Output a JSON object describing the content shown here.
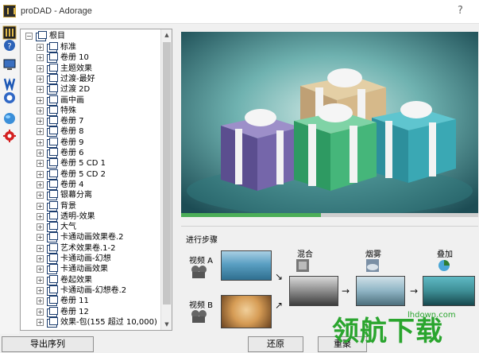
{
  "window": {
    "title": "proDAD - Adorage"
  },
  "titlebar": {
    "help": "?"
  },
  "tree": {
    "root": "根目",
    "items": [
      {
        "label": "标准"
      },
      {
        "label": "卷册 10"
      },
      {
        "label": "主题效果"
      },
      {
        "label": "过渡-最好"
      },
      {
        "label": "过渡 2D"
      },
      {
        "label": "画中画"
      },
      {
        "label": "特殊"
      },
      {
        "label": "卷册 7"
      },
      {
        "label": "卷册 8"
      },
      {
        "label": "卷册 9"
      },
      {
        "label": "卷册 6"
      },
      {
        "label": "卷册 5 CD 1"
      },
      {
        "label": "卷册 5 CD 2"
      },
      {
        "label": "卷册 4"
      },
      {
        "label": "银幕分离"
      },
      {
        "label": "背景"
      },
      {
        "label": "透明-效果"
      },
      {
        "label": "大气"
      },
      {
        "label": "卡通动画效果卷.2"
      },
      {
        "label": "艺术效果卷.1-2"
      },
      {
        "label": "卡通动画-幻想"
      },
      {
        "label": "卡通动画效果"
      },
      {
        "label": "卷起效果"
      },
      {
        "label": "卡通动画-幻想卷.2"
      },
      {
        "label": "卷册 11"
      },
      {
        "label": "卷册 12"
      },
      {
        "label": "效果-包(155 超过 10,000)"
      }
    ]
  },
  "preview": {
    "progress_fraction": 0.47
  },
  "process": {
    "title": "进行步骤",
    "video_a": "视频 A",
    "video_b": "视频 B",
    "mix": "混合",
    "fog": "烟雾",
    "overlay": "叠加"
  },
  "buttons": {
    "export": "导出序列",
    "restore": "还原",
    "reset": "重聚"
  },
  "watermark": {
    "text": "领航下载",
    "url": "lhdown.com"
  }
}
